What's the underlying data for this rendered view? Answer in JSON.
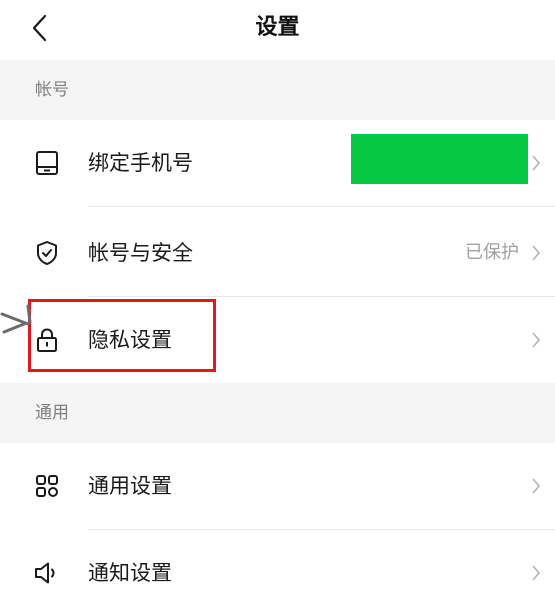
{
  "header": {
    "title": "设置",
    "back_icon": "chevron-left-icon"
  },
  "sections": [
    {
      "header": "帐号",
      "items": [
        {
          "label": "绑定手机号",
          "value": "",
          "icon": "phone-icon"
        },
        {
          "label": "帐号与安全",
          "value": "已保护",
          "icon": "shield-check-icon"
        },
        {
          "label": "隐私设置",
          "value": "",
          "icon": "lock-icon"
        }
      ]
    },
    {
      "header": "通用",
      "items": [
        {
          "label": "通用设置",
          "value": "",
          "icon": "grid-icon"
        },
        {
          "label": "通知设置",
          "value": "",
          "icon": "speaker-icon"
        }
      ]
    }
  ],
  "colors": {
    "redaction_block": "#07c843",
    "highlight_border": "#e3171f",
    "section_background": "#f5f5f5",
    "chevron": "#b3b3b3",
    "value_text": "#a0a0a0"
  }
}
